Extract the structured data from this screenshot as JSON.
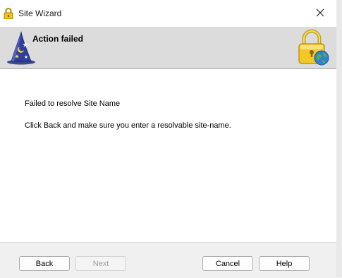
{
  "window": {
    "title": "Site Wizard",
    "title_icon": "lock-icon",
    "close_icon": "close-icon"
  },
  "header": {
    "title": "Action failed",
    "left_icon": "wizard-hat-icon",
    "right_icon": "lock-globe-icon"
  },
  "content": {
    "message_1": "Failed to resolve Site Name",
    "message_2": "Click Back and make sure you enter a resolvable site-name."
  },
  "footer": {
    "back_label": "Back",
    "next_label": "Next",
    "cancel_label": "Cancel",
    "help_label": "Help"
  }
}
